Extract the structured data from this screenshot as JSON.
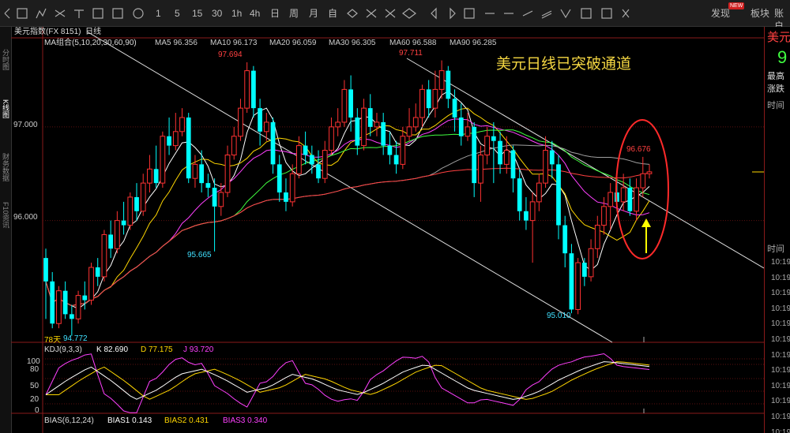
{
  "toolbar": {
    "nav_labels": [
      "1",
      "5",
      "15",
      "30",
      "1h",
      "4h",
      "日",
      "周",
      "月",
      "自"
    ],
    "right_labels": [
      "发现",
      "板块",
      "账户"
    ],
    "new_badge": "NEW"
  },
  "side_tabs": [
    "分时图",
    "K线图",
    "财务数据",
    "F10资讯"
  ],
  "header": {
    "symbol": "美元指数(FX 8151)",
    "period": "日线",
    "indicator": "MA组合(5,10,20,30,60,90)"
  },
  "ma_legend": [
    {
      "label": "MA5 96.356",
      "color": "#ffffff"
    },
    {
      "label": "MA10 96.173",
      "color": "#ffd700"
    },
    {
      "label": "MA20 96.059",
      "color": "#ff40ff"
    },
    {
      "label": "MA30 96.305",
      "color": "#40ff40"
    },
    {
      "label": "MA60 96.588",
      "color": "#a0a0a0"
    },
    {
      "label": "MA90 96.285",
      "color": "#ff4040"
    }
  ],
  "price_labels": {
    "high1": "97.694",
    "high2": "97.711",
    "low1": "95.665",
    "low2": "95.010",
    "low3": "94.772",
    "recent_high": "96.676",
    "days": "78天"
  },
  "y_axis": [
    "97.000",
    "96.000"
  ],
  "annotation": "美元日线已突破通道",
  "kdj": {
    "title": "KDJ(9,3,3)",
    "k": "K 82.690",
    "d": "D 77.175",
    "j": "J 93.720",
    "ticks": [
      "100",
      "80",
      "50",
      "20",
      "0"
    ]
  },
  "bias": {
    "title": "BIAS(6,12,24)",
    "b1": "BIAS1 0.143",
    "b2": "BIAS2 0.431",
    "b3": "BIAS3 0.340"
  },
  "right_panel": {
    "name": "美元",
    "price": "9",
    "high_label": "最高",
    "change_label": "涨跌",
    "time_label": "时间",
    "time_label2": "时间",
    "times": [
      "10:19",
      "10:19",
      "10:19",
      "10:19",
      "10:19",
      "10:19",
      "10:19",
      "10:19",
      "10:19",
      "10:19",
      "10:19",
      "10:19"
    ]
  },
  "colors": {
    "up": "#ff3232",
    "down": "#00ffff",
    "background": "#000000",
    "annotation": "#f5d742",
    "ellipse": "#ff2a2a",
    "arrow": "#ffff00",
    "channel": "#e0e0e0"
  },
  "chart_data": {
    "type": "candlestick",
    "title": "美元指数(FX 8151) 日线",
    "ylim": [
      94.7,
      97.9
    ],
    "yticks": [
      96.0,
      97.0
    ],
    "candles": [
      [
        95.6,
        95.35,
        95.7,
        94.95
      ],
      [
        95.35,
        94.9,
        95.45,
        94.85
      ],
      [
        94.9,
        95.25,
        95.3,
        94.85
      ],
      [
        95.25,
        95.0,
        95.35,
        94.95
      ],
      [
        95.0,
        94.95,
        95.1,
        94.77
      ],
      [
        94.95,
        95.2,
        95.25,
        94.9
      ],
      [
        95.2,
        95.15,
        95.35,
        95.05
      ],
      [
        95.15,
        95.5,
        95.55,
        95.1
      ],
      [
        95.5,
        95.4,
        95.6,
        95.3
      ],
      [
        95.4,
        95.85,
        95.9,
        95.35
      ],
      [
        95.85,
        95.7,
        96.0,
        95.6
      ],
      [
        95.7,
        96.0,
        96.1,
        95.65
      ],
      [
        96.0,
        95.95,
        96.2,
        95.85
      ],
      [
        95.95,
        96.25,
        96.3,
        95.9
      ],
      [
        96.25,
        96.1,
        96.4,
        96.0
      ],
      [
        96.1,
        96.4,
        96.5,
        96.05
      ],
      [
        96.4,
        96.55,
        96.7,
        96.3
      ],
      [
        96.55,
        96.4,
        96.8,
        96.35
      ],
      [
        96.4,
        96.9,
        96.95,
        96.35
      ],
      [
        96.9,
        96.8,
        97.1,
        96.7
      ],
      [
        96.8,
        96.95,
        97.15,
        96.75
      ],
      [
        96.95,
        97.1,
        97.2,
        96.9
      ],
      [
        97.1,
        96.45,
        97.15,
        96.4
      ],
      [
        96.45,
        96.6,
        96.7,
        96.35
      ],
      [
        96.6,
        96.4,
        96.75,
        96.3
      ],
      [
        96.4,
        96.35,
        96.5,
        96.25
      ],
      [
        96.35,
        96.15,
        96.45,
        95.67
      ],
      [
        96.15,
        96.3,
        96.4,
        96.05
      ],
      [
        96.3,
        96.7,
        96.8,
        96.25
      ],
      [
        96.7,
        96.9,
        97.0,
        96.65
      ],
      [
        96.9,
        97.2,
        97.3,
        96.85
      ],
      [
        97.2,
        97.6,
        97.69,
        97.15
      ],
      [
        97.6,
        97.2,
        97.65,
        97.1
      ],
      [
        97.2,
        96.95,
        97.3,
        96.8
      ],
      [
        96.95,
        97.05,
        97.15,
        96.85
      ],
      [
        97.05,
        96.6,
        97.1,
        96.5
      ],
      [
        96.6,
        96.3,
        96.7,
        96.2
      ],
      [
        96.3,
        96.2,
        96.45,
        96.1
      ],
      [
        96.2,
        96.5,
        96.6,
        96.15
      ],
      [
        96.5,
        96.8,
        96.9,
        96.45
      ],
      [
        96.8,
        96.7,
        96.95,
        96.6
      ],
      [
        96.7,
        96.6,
        96.8,
        96.5
      ],
      [
        96.6,
        96.45,
        96.75,
        96.4
      ],
      [
        96.45,
        96.75,
        96.85,
        96.4
      ],
      [
        96.75,
        97.0,
        97.1,
        96.7
      ],
      [
        97.0,
        97.05,
        97.2,
        96.9
      ],
      [
        97.05,
        97.4,
        97.5,
        97.0
      ],
      [
        97.4,
        97.1,
        97.55,
        96.95
      ],
      [
        97.1,
        96.8,
        97.2,
        96.7
      ],
      [
        96.8,
        97.2,
        97.3,
        96.75
      ],
      [
        97.2,
        97.0,
        97.35,
        96.9
      ],
      [
        97.0,
        97.05,
        97.15,
        96.9
      ],
      [
        97.05,
        96.8,
        97.15,
        96.7
      ],
      [
        96.8,
        96.7,
        96.95,
        96.6
      ],
      [
        96.7,
        96.6,
        96.85,
        96.5
      ],
      [
        96.6,
        96.9,
        97.0,
        96.55
      ],
      [
        96.9,
        97.0,
        97.2,
        96.85
      ],
      [
        97.0,
        97.1,
        97.25,
        96.95
      ],
      [
        97.1,
        97.4,
        97.45,
        97.0
      ],
      [
        97.4,
        97.2,
        97.5,
        97.1
      ],
      [
        97.2,
        97.4,
        97.6,
        97.1
      ],
      [
        97.4,
        97.6,
        97.71,
        97.3
      ],
      [
        97.6,
        97.3,
        97.65,
        97.2
      ],
      [
        97.3,
        97.1,
        97.4,
        96.95
      ],
      [
        97.1,
        96.9,
        97.25,
        96.8
      ],
      [
        96.9,
        97.0,
        97.15,
        96.85
      ],
      [
        97.0,
        96.4,
        97.05,
        96.25
      ],
      [
        96.4,
        96.7,
        96.8,
        96.2
      ],
      [
        96.7,
        96.9,
        97.0,
        96.6
      ],
      [
        96.9,
        96.85,
        97.05,
        96.4
      ],
      [
        96.85,
        96.6,
        96.95,
        96.5
      ],
      [
        96.6,
        96.75,
        96.9,
        96.5
      ],
      [
        96.75,
        96.45,
        96.8,
        96.3
      ],
      [
        96.45,
        96.1,
        96.55,
        96.0
      ],
      [
        96.1,
        96.0,
        96.25,
        95.9
      ],
      [
        96.0,
        96.2,
        96.3,
        95.55
      ],
      [
        96.2,
        96.4,
        96.5,
        96.1
      ],
      [
        96.4,
        96.75,
        96.9,
        96.35
      ],
      [
        96.75,
        96.6,
        96.85,
        96.45
      ],
      [
        96.6,
        95.95,
        96.7,
        95.8
      ],
      [
        95.95,
        95.65,
        96.05,
        95.5
      ],
      [
        95.65,
        95.05,
        95.75,
        95.01
      ],
      [
        95.05,
        95.55,
        95.6,
        95.0
      ],
      [
        95.55,
        95.4,
        95.6,
        95.3
      ],
      [
        95.4,
        95.7,
        95.8,
        95.35
      ],
      [
        95.7,
        95.95,
        96.05,
        95.6
      ],
      [
        95.95,
        96.15,
        96.25,
        95.85
      ],
      [
        96.15,
        96.3,
        96.4,
        95.9
      ],
      [
        96.3,
        96.2,
        96.45,
        96.1
      ],
      [
        96.2,
        96.35,
        96.5,
        96.1
      ],
      [
        96.35,
        96.1,
        96.45,
        96.05
      ],
      [
        96.1,
        96.35,
        96.45,
        96.0
      ],
      [
        96.35,
        96.5,
        96.68,
        96.25
      ],
      [
        96.5,
        96.52,
        96.6,
        96.45
      ]
    ]
  }
}
